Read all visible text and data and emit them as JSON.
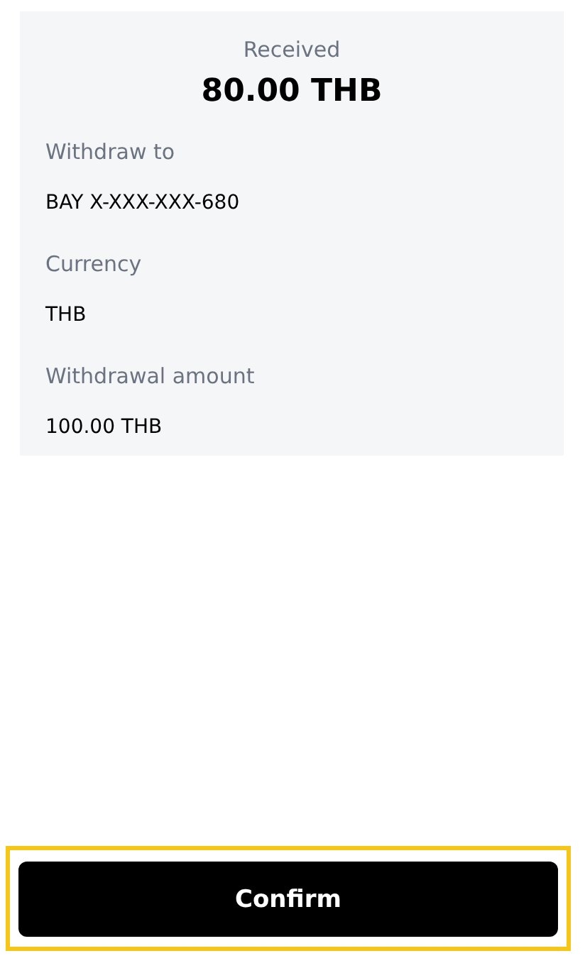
{
  "summary": {
    "label": "Received",
    "amount": "80.00 THB",
    "details": [
      {
        "label": "Withdraw to",
        "value": "BAY X-XXX-XXX-680"
      },
      {
        "label": "Currency",
        "value": "THB"
      },
      {
        "label": "Withdrawal amount",
        "value": "100.00 THB"
      }
    ]
  },
  "confirm_button": {
    "label": "Confirm",
    "highlighted": true
  }
}
